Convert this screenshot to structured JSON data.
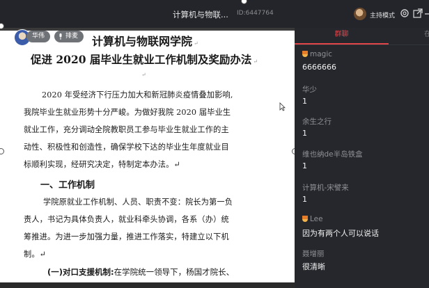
{
  "topbar": {
    "title": "计算机与物联...",
    "id_label": "ID:6447764",
    "host_label": "主持模式",
    "icons": [
      "host-avatar",
      "settings-icon",
      "external-window-icon",
      "minimize-icon"
    ]
  },
  "document": {
    "badges": {
      "user": "华伟",
      "sort": "排麦"
    },
    "title_line1": "计算机与物联网学院",
    "title_line2": "促进 2020 届毕业生就业工作机制及奖励办法",
    "return_mark": "↵",
    "paragraphs": [
      "2020 年受经济下行压力加大和新冠肺炎疫情叠加影响,",
      "我院毕业生就业形势十分严峻。为做好我院 2020 届毕业生",
      "就业工作，充分调动全院教职员工参与毕业生就业工作的主",
      "动性、积极性和创造性，确保学校下达的毕业生年度就业目",
      "标顺利实现，经研究决定，特制定本办法。↵"
    ],
    "section_title": "一、工作机制",
    "section_lines": [
      "学院原就业工作机制、人员、职责不变：院长为第一负",
      "责人，书记为具体负责人，就业科牵头协调，各系（办）统",
      "筹推进。为进一步加强力量，推进工作落实，特建立以下机",
      "制。↵"
    ],
    "bottom_bold": "(一)对口支援机制:",
    "bottom_rest": "在学院统一领导下，杨国才院长、"
  },
  "panel": {
    "tab_chat": "群聊",
    "tab_other": "在",
    "messages": [
      {
        "name": "magic",
        "text": "6666666",
        "medal": true
      },
      {
        "name": "华少",
        "text": "1",
        "medal": false
      },
      {
        "name": "余生之行",
        "text": "1",
        "medal": false
      },
      {
        "name": "维也纳de半岛铁盒",
        "text": "1",
        "medal": false
      },
      {
        "name": "计算机-宋譬来",
        "text": "1",
        "medal": false
      },
      {
        "name": "Lee",
        "text": "因为有两个人可以说话",
        "medal": true
      },
      {
        "name": "聂增丽",
        "text": "很清晰",
        "medal": false
      }
    ]
  }
}
